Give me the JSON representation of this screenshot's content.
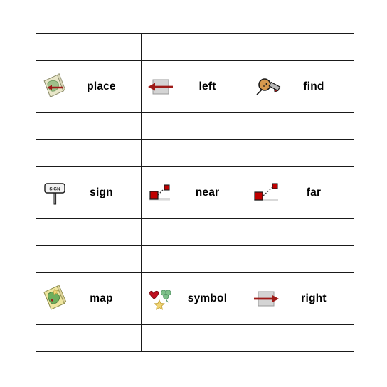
{
  "board": {
    "kind": "bingo-card",
    "columns": 3,
    "rows": 7,
    "colors": {
      "grid_line": "#1a1a1a",
      "card_border": "#000000",
      "background": "#ffffff",
      "arrow_red": "#9e1b18",
      "square_gray": "#d4d4d4",
      "square_red": "#c00000",
      "map_paper": "#e9e7c9",
      "map_green": "#9fc08a",
      "map_yellow": "#efe6a0",
      "lens_tan": "#d79a4e",
      "heart_red": "#c01020",
      "clover_green": "#7fc08a",
      "star_yellow": "#f2d574",
      "sign_plate": "#f2f2f2"
    },
    "rows_data": [
      {
        "type": "spacer",
        "cells": [
          {
            "label": "",
            "icon": ""
          },
          {
            "label": "",
            "icon": ""
          },
          {
            "label": "",
            "icon": ""
          }
        ]
      },
      {
        "type": "cards",
        "cells": [
          {
            "label": "place",
            "icon": "map-with-left-arrow-icon"
          },
          {
            "label": "left",
            "icon": "left-arrow-icon"
          },
          {
            "label": "find",
            "icon": "magnifying-glass-icon"
          }
        ]
      },
      {
        "type": "spacer",
        "cells": [
          {
            "label": "",
            "icon": ""
          },
          {
            "label": "",
            "icon": ""
          },
          {
            "label": "",
            "icon": ""
          }
        ]
      },
      {
        "type": "spacer",
        "cells": [
          {
            "label": "",
            "icon": ""
          },
          {
            "label": "",
            "icon": ""
          },
          {
            "label": "",
            "icon": ""
          }
        ]
      },
      {
        "type": "cards",
        "cells": [
          {
            "label": "sign",
            "icon": "signpost-icon"
          },
          {
            "label": "near",
            "icon": "two-squares-near-icon"
          },
          {
            "label": "far",
            "icon": "two-squares-far-icon"
          }
        ]
      },
      {
        "type": "spacer",
        "cells": [
          {
            "label": "",
            "icon": ""
          },
          {
            "label": "",
            "icon": ""
          },
          {
            "label": "",
            "icon": ""
          }
        ]
      },
      {
        "type": "spacer",
        "cells": [
          {
            "label": "",
            "icon": ""
          },
          {
            "label": "",
            "icon": ""
          },
          {
            "label": "",
            "icon": ""
          }
        ]
      },
      {
        "type": "cards",
        "cells": [
          {
            "label": "map",
            "icon": "folded-map-icon"
          },
          {
            "label": "symbol",
            "icon": "heart-clover-star-icon"
          },
          {
            "label": "right",
            "icon": "right-arrow-icon"
          }
        ]
      },
      {
        "type": "spacer",
        "cells": [
          {
            "label": "",
            "icon": ""
          },
          {
            "label": "",
            "icon": ""
          },
          {
            "label": "",
            "icon": ""
          }
        ]
      }
    ],
    "sign_plate_text": "SIGN"
  }
}
